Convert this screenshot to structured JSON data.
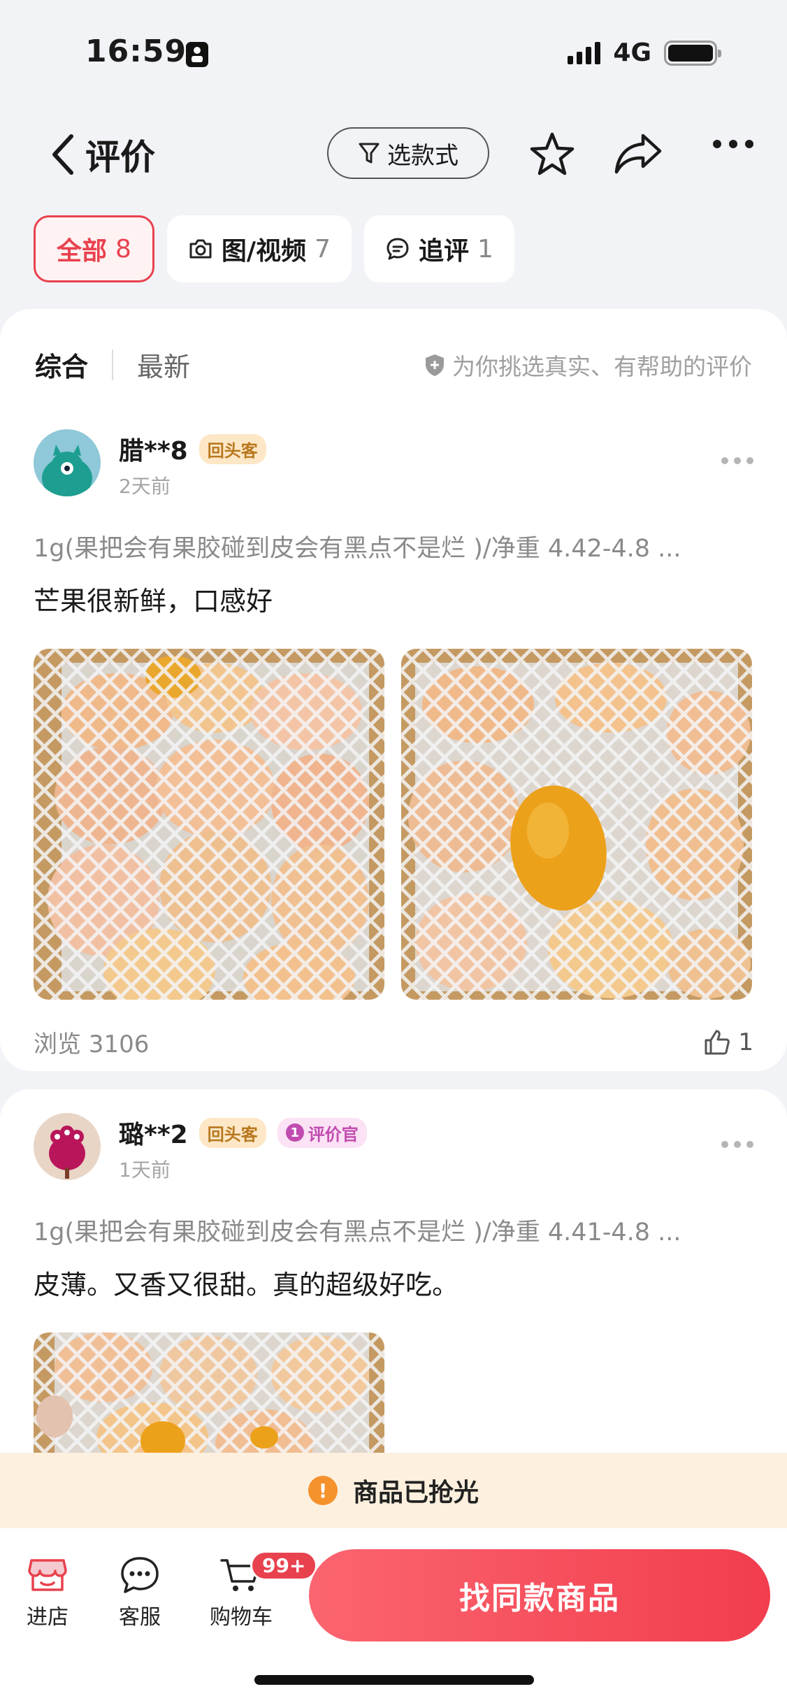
{
  "status_bar": {
    "time": "16:59",
    "network": "4G"
  },
  "header": {
    "title": "评价",
    "style_filter_label": "选款式"
  },
  "filters": [
    {
      "label": "全部",
      "count": "8"
    },
    {
      "label": "图/视频",
      "count": "7"
    },
    {
      "label": "追评",
      "count": "1"
    }
  ],
  "sort": {
    "tabs": [
      "综合",
      "最新"
    ],
    "hint": "为你挑选真实、有帮助的评价"
  },
  "reviews": [
    {
      "user": "腊**8",
      "tags": [
        "回头客"
      ],
      "time": "2天前",
      "spec": "1g(果把会有果胶碰到皮会有黑点不是烂 )/净重 4.42-4.8 ...",
      "content": "芒果很新鲜，口感好",
      "views": "浏览 3106",
      "likes": "1"
    },
    {
      "user": "璐**2",
      "tags": [
        "回头客",
        "评价官"
      ],
      "official_badge_num": "1",
      "time": "1天前",
      "spec": "1g(果把会有果胶碰到皮会有黑点不是烂 )/净重 4.41-4.8 ...",
      "content": "皮薄。又香又很甜。真的超级好吃。"
    }
  ],
  "notice": {
    "icon": "!",
    "text": "商品已抢光"
  },
  "bottom_bar": {
    "store": "进店",
    "service": "客服",
    "cart": "购物车",
    "cart_badge": "99+",
    "cta": "找同款商品"
  }
}
